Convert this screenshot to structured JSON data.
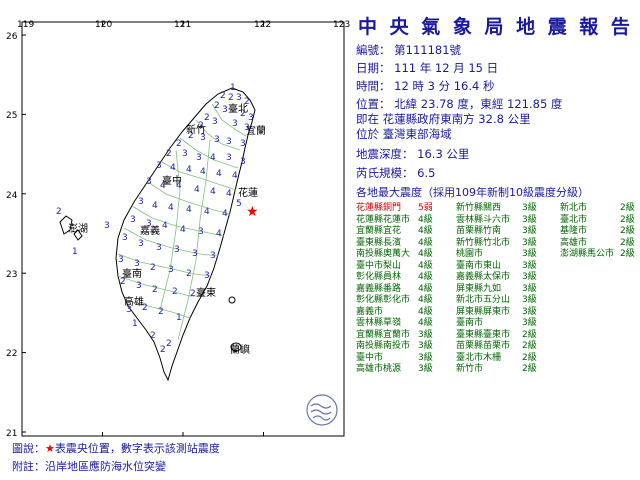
{
  "title": "中 央 氣 象 局 地 震 報 告",
  "report": {
    "number": "編號： 第111181號",
    "date": "日期： 111 年 12 月 15 日",
    "time": "時間： 12 時 3 分 16.4 秒",
    "location": "位置： 北緯 23.78 度，東經 121.85 度",
    "location_desc": "即在 花蓮縣政府東南方 32.8 公里",
    "region": "位於 臺灣東部海域",
    "depth": "地震深度： 16.3 公里",
    "magnitude": "芮氏規模： 6.5",
    "intensity_header": "各地最大震度（採用109年新制10級震度分級）"
  },
  "intensity_table": [
    [
      {
        "place": "花蓮縣銅門",
        "level": "5弱"
      },
      {
        "place": "新竹縣關西",
        "level": "3級"
      },
      {
        "place": "新北市",
        "level": "2級"
      }
    ],
    [
      {
        "place": "花蓮縣花蓮市",
        "level": "4級"
      },
      {
        "place": "雲林縣斗六市",
        "level": "3級"
      },
      {
        "place": "臺北市",
        "level": "2級"
      }
    ],
    [
      {
        "place": "宜蘭縣宜花",
        "level": "4級"
      },
      {
        "place": "苗栗縣竹南",
        "level": "3級"
      },
      {
        "place": "基隆市",
        "level": "2級"
      }
    ],
    [
      {
        "place": "臺東縣長濱",
        "level": "4級"
      },
      {
        "place": "新竹縣竹北市",
        "level": "3級"
      },
      {
        "place": "高雄市",
        "level": "2級"
      }
    ],
    [
      {
        "place": "南投縣奧萬大",
        "level": "4級"
      },
      {
        "place": "桃園市",
        "level": "3級"
      },
      {
        "place": "澎湖縣馬公市",
        "level": "2級"
      }
    ],
    [
      {
        "place": "臺中市梨山",
        "level": "4級"
      },
      {
        "place": "臺南市東山",
        "level": "3級"
      }
    ],
    [
      {
        "place": "彰化縣員林",
        "level": "4級"
      },
      {
        "place": "嘉義縣太保市",
        "level": "3級"
      }
    ],
    [
      {
        "place": "嘉義縣番路",
        "level": "4級"
      },
      {
        "place": "屏東縣九如",
        "level": "3級"
      }
    ],
    [
      {
        "place": "彰化縣彰化市",
        "level": "4級"
      },
      {
        "place": "新北市五分山",
        "level": "3級"
      }
    ],
    [
      {
        "place": "嘉義市",
        "level": "4級"
      },
      {
        "place": "屏東縣屏東市",
        "level": "3級"
      }
    ],
    [
      {
        "place": "雲林縣草嶺",
        "level": "4級"
      },
      {
        "place": "臺南市",
        "level": "3級"
      }
    ],
    [
      {
        "place": "宜蘭縣宜蘭市",
        "level": "3級"
      },
      {
        "place": "臺東縣臺東市",
        "level": "2級"
      }
    ],
    [
      {
        "place": "南投縣南投市",
        "level": "3級"
      },
      {
        "place": "苗栗縣苗栗市",
        "level": "2級"
      }
    ],
    [
      {
        "place": "臺中市",
        "level": "3級"
      },
      {
        "place": "臺北市木柵",
        "level": "2級"
      }
    ],
    [
      {
        "place": "高雄市桃源",
        "level": "3級"
      },
      {
        "place": "新竹市",
        "level": "2級"
      }
    ]
  ],
  "footer": {
    "legend_prefix": "圖說：",
    "legend_star": "★",
    "legend_text": "表震央位置，數字表示該測站震度",
    "note": "附註：沿岸地區應防海水位突變"
  },
  "map": {
    "lon_labels": [
      "119",
      "120",
      "121",
      "122",
      "123"
    ],
    "lat_labels": [
      "26",
      "25",
      "24",
      "23",
      "22",
      "21"
    ],
    "scale_unit": "km",
    "scale_labels": [
      "0",
      "50",
      "100"
    ],
    "place_labels": [
      "臺北",
      "宜蘭",
      "新竹",
      "臺中",
      "花蓮",
      "嘉義",
      "澎湖",
      "臺南",
      "高雄",
      "臺東",
      "蘭嶼"
    ],
    "land_color": "#ffffff",
    "sea_color": "#ffffff",
    "station_color": "#2222aa",
    "county_line_color": "#7fbf7f",
    "epicenter_color": "#ee0000"
  }
}
